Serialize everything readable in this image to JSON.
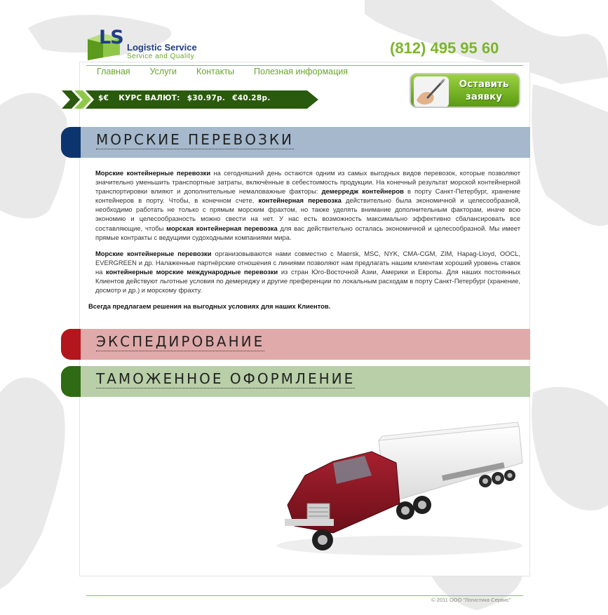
{
  "logo": {
    "mark": "LS",
    "name": "Logistic Service",
    "tagline": "Service and Quality"
  },
  "phone": "(812) 495 95 60",
  "nav": [
    "Главная",
    "Услуги",
    "Контакты",
    "Полезная информация"
  ],
  "rates": {
    "icon": "$€",
    "label": "КУРС ВАЛЮТ:",
    "usd": "$30.97р.",
    "eur": "€40.28р."
  },
  "order_button": {
    "line1": "Оставить",
    "line2": "заявку"
  },
  "sections": {
    "sea": "МОРСКИЕ ПЕРЕВОЗКИ",
    "expediting": "ЭКСПЕДИРОВАНИЕ",
    "customs": "ТАМОЖЕННОЕ ОФОРМЛЕНИЕ"
  },
  "article": {
    "p1": [
      {
        "b": true,
        "t": "Морские контейнерные перевозки"
      },
      {
        "b": false,
        "t": " на сегодняшний день остаются одним из самых выгодных видов перевозок, которые позволяют значительно уменьшить транспортные затраты, включённые в себестоимость продукции. На конечный результат морской контейнерной транспортировки влияют и дополнительные немаловажные факторы: "
      },
      {
        "b": true,
        "t": "демерредж контейнеров"
      },
      {
        "b": false,
        "t": " в порту Санкт-Петербург, хранение контейнеров в порту. Чтобы, в конечном счете, "
      },
      {
        "b": true,
        "t": "контейнерная перевозка"
      },
      {
        "b": false,
        "t": " действительно была экономичной и целесообразной, необходимо работать не только с прямым морским фрахтом, но также уделять внимание дополнительным факторам, иначе всю экономию и целесообразность можно свести на нет. У нас есть возможность максимально эффективно сбалансировать все составляющие, чтобы "
      },
      {
        "b": true,
        "t": "морская контейнерная перевозка"
      },
      {
        "b": false,
        "t": " для вас действительно осталась экономичной и целесообразной. Мы имеет прямые контракты с ведущими судоходными компаниями мира."
      }
    ],
    "p2": [
      {
        "b": true,
        "t": "Морские контейнерные перевозки"
      },
      {
        "b": false,
        "t": " организовываются нами совместно с Maersk, MSC, NYK, CMA-CGM, ZIM, Hapag-Lloyd, OOCL, EVERGREEN и др. Налаженные партнёрские отношения с линиями позволяют нам предлагать нашим клиентам хороший уровень ставок на "
      },
      {
        "b": true,
        "t": "контейнерные морские международные перевозки"
      },
      {
        "b": false,
        "t": " из стран Юго-Восточной Азии, Америки и Европы. Для наших постоянных Клиентов действуют льготные условия по демереджу и другие преференции по локальным расходам в порту Санкт-Петербург (хранение, досмотр и др.) и морскому фрахту."
      }
    ],
    "p3": "Всегда предлагаем решения на выгодных условиях для наших Клиентов."
  },
  "footer": {
    "copyright": "© 2011 ООО \"Логистика Сервис\""
  },
  "colors": {
    "accent_green": "#7cb52c",
    "sea_dark": "#0c3570",
    "sea_light": "#a5b8cc",
    "exp_dark": "#b3161d",
    "exp_light": "#e1aaaa",
    "cus_dark": "#2f6b14",
    "cus_light": "#b8cfa8"
  }
}
